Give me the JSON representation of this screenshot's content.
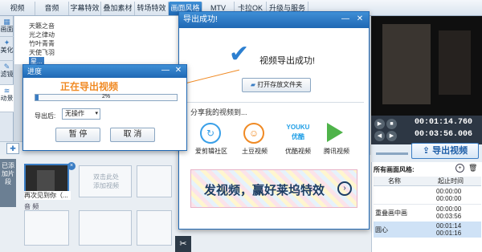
{
  "tabs": [
    "视频",
    "音频",
    "字幕特效",
    "叠加素材",
    "转场特效",
    "画面风格",
    "MTV",
    "卡拉OK",
    "升级与服务"
  ],
  "left_tabs": [
    "画面",
    "美化",
    "滤镜",
    "动景"
  ],
  "effects": [
    "天籁之音",
    "光之律动",
    "竹叶青青",
    "天使飞羽",
    "星..."
  ],
  "progress": {
    "title": "进度",
    "heading": "正在导出视频",
    "percent_label": "2%",
    "percent": 2,
    "after_label": "导出后:",
    "after_value": "无操作",
    "pause": "暂 停",
    "cancel": "取 消"
  },
  "dialog": {
    "title": "导出成功!",
    "message": "视频导出成功!",
    "open_folder": "打开存放文件夹",
    "share_label": "分享我的视频到...",
    "share_items": [
      "爱剪辑社区",
      "土豆视频",
      "优酷视频",
      "腾讯视频"
    ],
    "youku_text": "YOUKU\n优酷",
    "banner": "发视频，赢好莱坞特效"
  },
  "timeline": {
    "side_label": "已添加片段",
    "clip_label": "再次见到你（...",
    "add_hint": "双击此处\n添加视频",
    "audio_label": "音 频"
  },
  "player": {
    "time_current": "00:01:14.760",
    "time_total": "00:03:56.006",
    "export": "导出视频"
  },
  "style_panel": {
    "title": "所有画面风格:",
    "headers": [
      "名称",
      "起止时间"
    ],
    "rows": [
      {
        "name": "",
        "start": "00:00:00",
        "end": "00:00:00"
      },
      {
        "name": "重叠画中画",
        "start": "00:00:00",
        "end": "00:03:56"
      },
      {
        "name": "圆心",
        "start": "00:01:14",
        "end": "00:01:16"
      }
    ]
  }
}
